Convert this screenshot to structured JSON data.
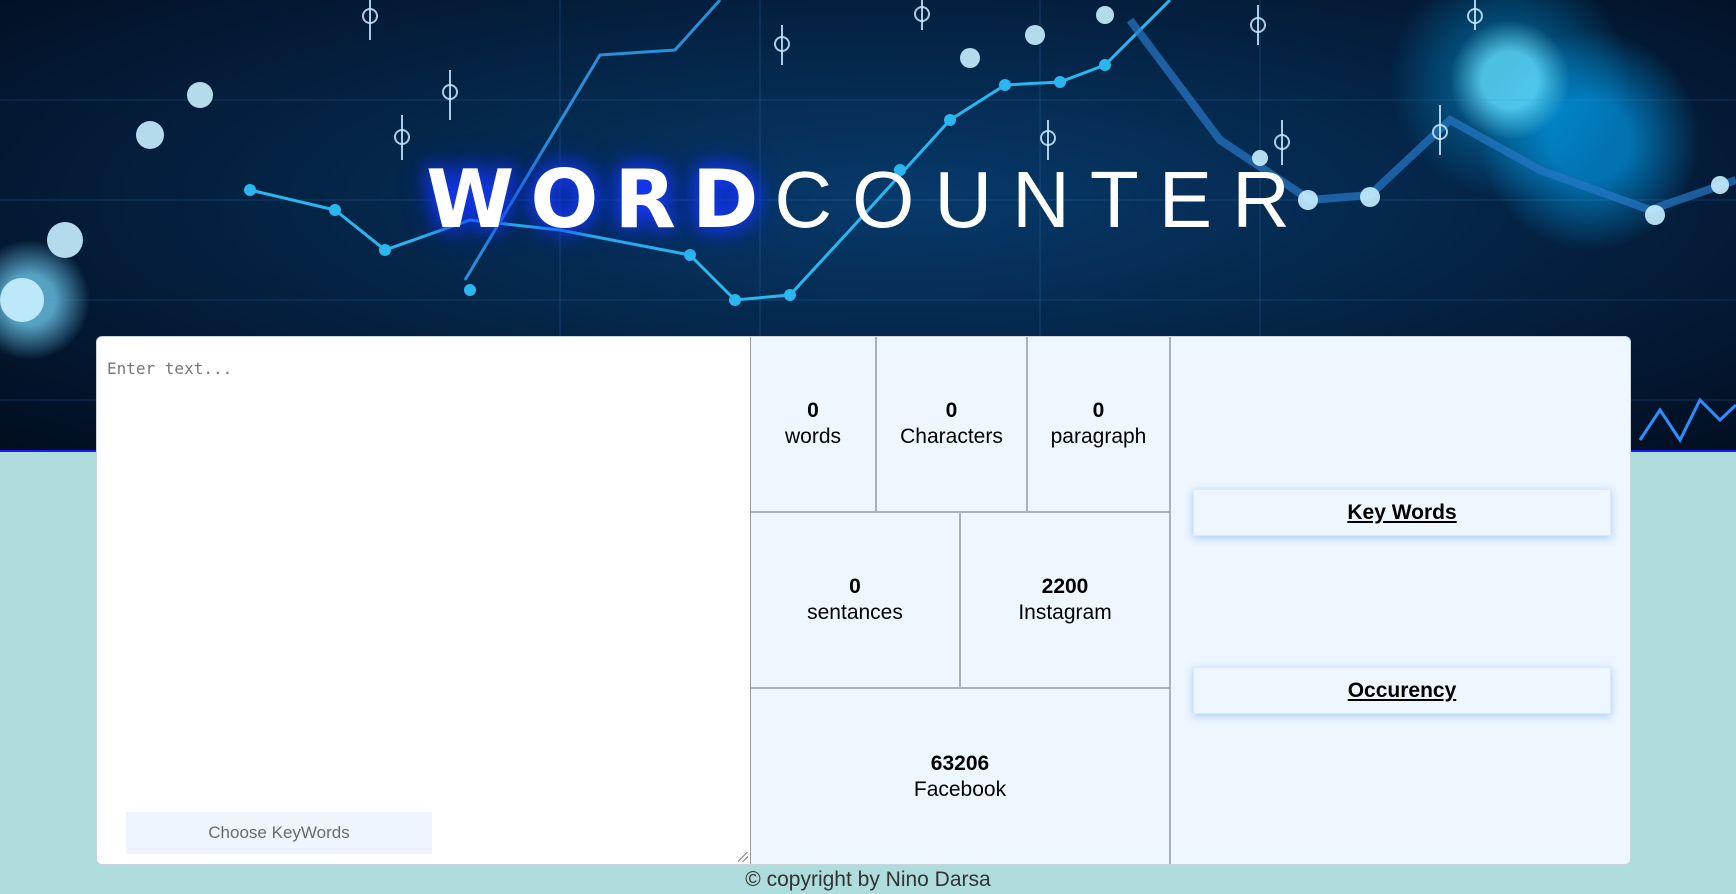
{
  "header": {
    "title_bold": "WORD",
    "title_light": "COUNTER"
  },
  "editor": {
    "placeholder": "Enter text...",
    "choose_keywords_label": "Choose KeyWords"
  },
  "stats": {
    "words": {
      "value": "0",
      "label": "words"
    },
    "characters": {
      "value": "0",
      "label": "Characters"
    },
    "paragraph": {
      "value": "0",
      "label": "paragraph"
    },
    "sentances": {
      "value": "0",
      "label": "sentances"
    },
    "instagram": {
      "value": "2200",
      "label": "Instagram"
    },
    "facebook": {
      "value": "63206",
      "label": "Facebook"
    }
  },
  "side": {
    "keywords_label": "Key Words",
    "occurency_label": "Occurency"
  },
  "footer": {
    "copyright": "© copyright by Nino Darsa"
  },
  "colors": {
    "page_bg": "#afdcdc",
    "panel_bg": "#eef6ff",
    "title_glow": "#1a3cff"
  }
}
